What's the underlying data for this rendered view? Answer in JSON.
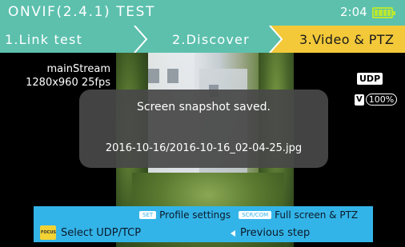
{
  "header": {
    "title": "ONVIF(2.4.1) TEST",
    "time": "2:04"
  },
  "steps": [
    {
      "label": "1.Link test"
    },
    {
      "label": "2.Discover"
    },
    {
      "label": "3.Video & PTZ"
    }
  ],
  "video": {
    "stream_name": "mainStream",
    "stream_resolution": "1280x960 25fps",
    "protocol_badge": "UDP",
    "volume_letter": "V",
    "volume_level": "100%"
  },
  "toast": {
    "title": "Screen snapshot saved.",
    "path": "2016-10-16/2016-10-16_02-04-25.jpg"
  },
  "help": {
    "set_key": "SET",
    "set_text": "Profile settings",
    "scr_key": "SCR/COM",
    "scr_text": "Full screen & PTZ",
    "focus_key": "FOCUS",
    "focus_text": "Select UDP/TCP",
    "prev_text": "Previous step"
  },
  "colors": {
    "titlebar": "#5cc0ad",
    "stepbar": "#5cc0ad",
    "active_step": "#f3c93a",
    "helpbar": "#33b4e8",
    "battery": "#b9e833"
  }
}
